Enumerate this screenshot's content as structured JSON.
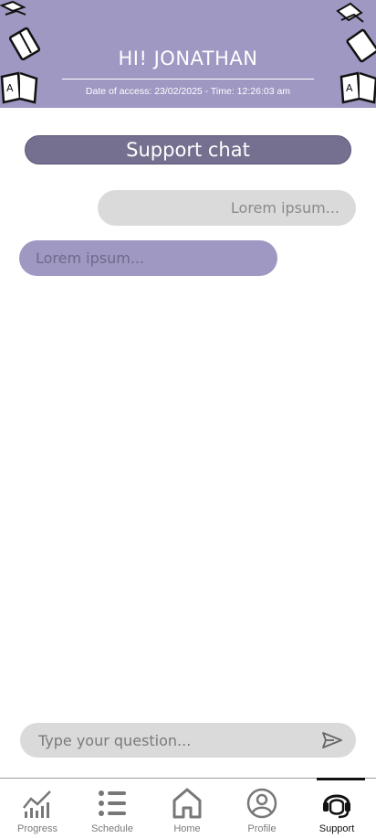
{
  "header": {
    "greeting": "HI! JONATHAN",
    "access_info": "Date of access: 23/02/2025 - Time: 12:26:03 am"
  },
  "chat": {
    "title": "Support chat",
    "messages": [
      {
        "direction": "outgoing",
        "text": "Lorem ipsum..."
      },
      {
        "direction": "incoming",
        "text": "Lorem ipsum..."
      }
    ]
  },
  "composer": {
    "placeholder": "Type your question...",
    "value": ""
  },
  "nav": {
    "items": [
      {
        "label": "Progress",
        "icon": "chart-icon"
      },
      {
        "label": "Schedule",
        "icon": "list-icon"
      },
      {
        "label": "Home",
        "icon": "home-icon"
      },
      {
        "label": "Profile",
        "icon": "user-icon"
      },
      {
        "label": "Support",
        "icon": "headset-icon"
      }
    ],
    "active": "Support"
  },
  "colors": {
    "header_bg": "#9e98c2",
    "title_bg": "#75708f",
    "incoming_bubble": "#9e98c2",
    "outgoing_bubble": "#dadada"
  }
}
